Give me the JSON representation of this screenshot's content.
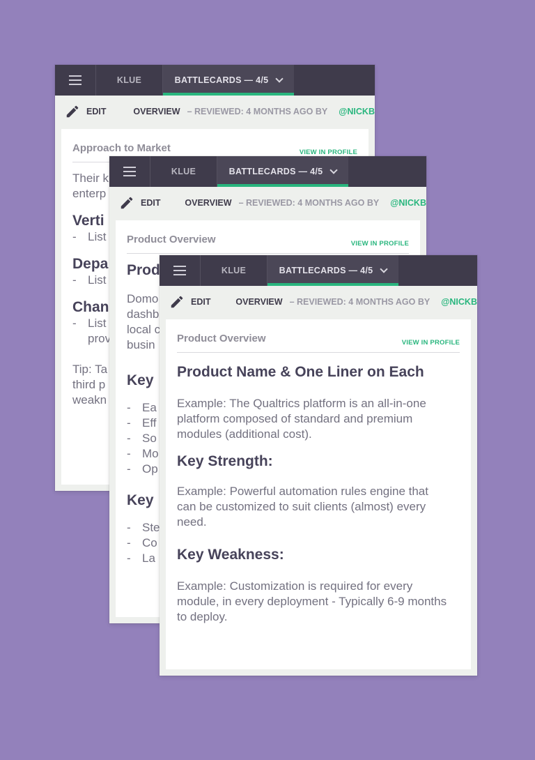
{
  "colors": {
    "background": "#9381bb",
    "topbar": "#3f3b4b",
    "accent": "#29b67e",
    "card": "#eef0ed"
  },
  "cards": [
    {
      "nav": {
        "menu_icon": "hamburger-menu-icon",
        "tab_klue": "KLUE",
        "tab_battlecards": "BATTLECARDS — 4/5",
        "dropdown_icon": "chevron-down-icon"
      },
      "toolbar": {
        "edit_icon": "pencil-icon",
        "edit": "EDIT",
        "overview": "OVERVIEW",
        "reviewed": "– REVIEWED: 4 MONTHS AGO BY",
        "user": "@NICKB"
      },
      "section": {
        "title": "Approach to Market",
        "view_link": "VIEW IN PROFILE"
      },
      "content": {
        "intro_1": "Their k",
        "intro_2": "enterp",
        "h_vertical": "Verti",
        "vertical_item": "List",
        "h_department": "Depa",
        "department_item": "List",
        "h_channel": "Chan",
        "channel_item": "List",
        "channel_item_cont": "prov",
        "tip_1": "Tip: Ta",
        "tip_2": "third p",
        "tip_3": "weakn"
      }
    },
    {
      "nav": {
        "menu_icon": "hamburger-menu-icon",
        "tab_klue": "KLUE",
        "tab_battlecards": "BATTLECARDS — 4/5",
        "dropdown_icon": "chevron-down-icon"
      },
      "toolbar": {
        "edit_icon": "pencil-icon",
        "edit": "EDIT",
        "overview": "OVERVIEW",
        "reviewed": "– REVIEWED: 4 MONTHS AGO BY",
        "user": "@NICKB"
      },
      "section": {
        "title": "Product Overview",
        "view_link": "VIEW IN PROFILE"
      },
      "content": {
        "h_product": "Prod",
        "desc_1": "Domo",
        "desc_2": "dashb",
        "desc_3": "local c",
        "desc_4": "busin",
        "h_strengths": "Key",
        "strengths": [
          "Ea",
          "Eff",
          "So",
          "Mo",
          "Op"
        ],
        "h_weaknesses": "Key",
        "weaknesses": [
          "Ste",
          "Co",
          "La"
        ]
      }
    },
    {
      "nav": {
        "menu_icon": "hamburger-menu-icon",
        "tab_klue": "KLUE",
        "tab_battlecards": "BATTLECARDS — 4/5",
        "dropdown_icon": "chevron-down-icon"
      },
      "toolbar": {
        "edit_icon": "pencil-icon",
        "edit": "EDIT",
        "overview": "OVERVIEW",
        "reviewed": "– REVIEWED: 4 MONTHS AGO BY",
        "user": "@NICKB"
      },
      "section": {
        "title": "Product Overview",
        "view_link": "VIEW IN PROFILE"
      },
      "content": {
        "h_name": "Product Name & One Liner on Each",
        "name_text": "Example: The Qualtrics platform is an all-in-one platform composed of standard and premium modules (additional cost).",
        "h_strength": "Key Strength:",
        "strength_text": "Example: Powerful automation rules engine that can be customized to suit clients (almost) every need.",
        "h_weakness": "Key Weakness:",
        "weakness_text": "Example: Customization is required for every module, in every deployment - Typically 6-9 months to deploy."
      }
    }
  ]
}
